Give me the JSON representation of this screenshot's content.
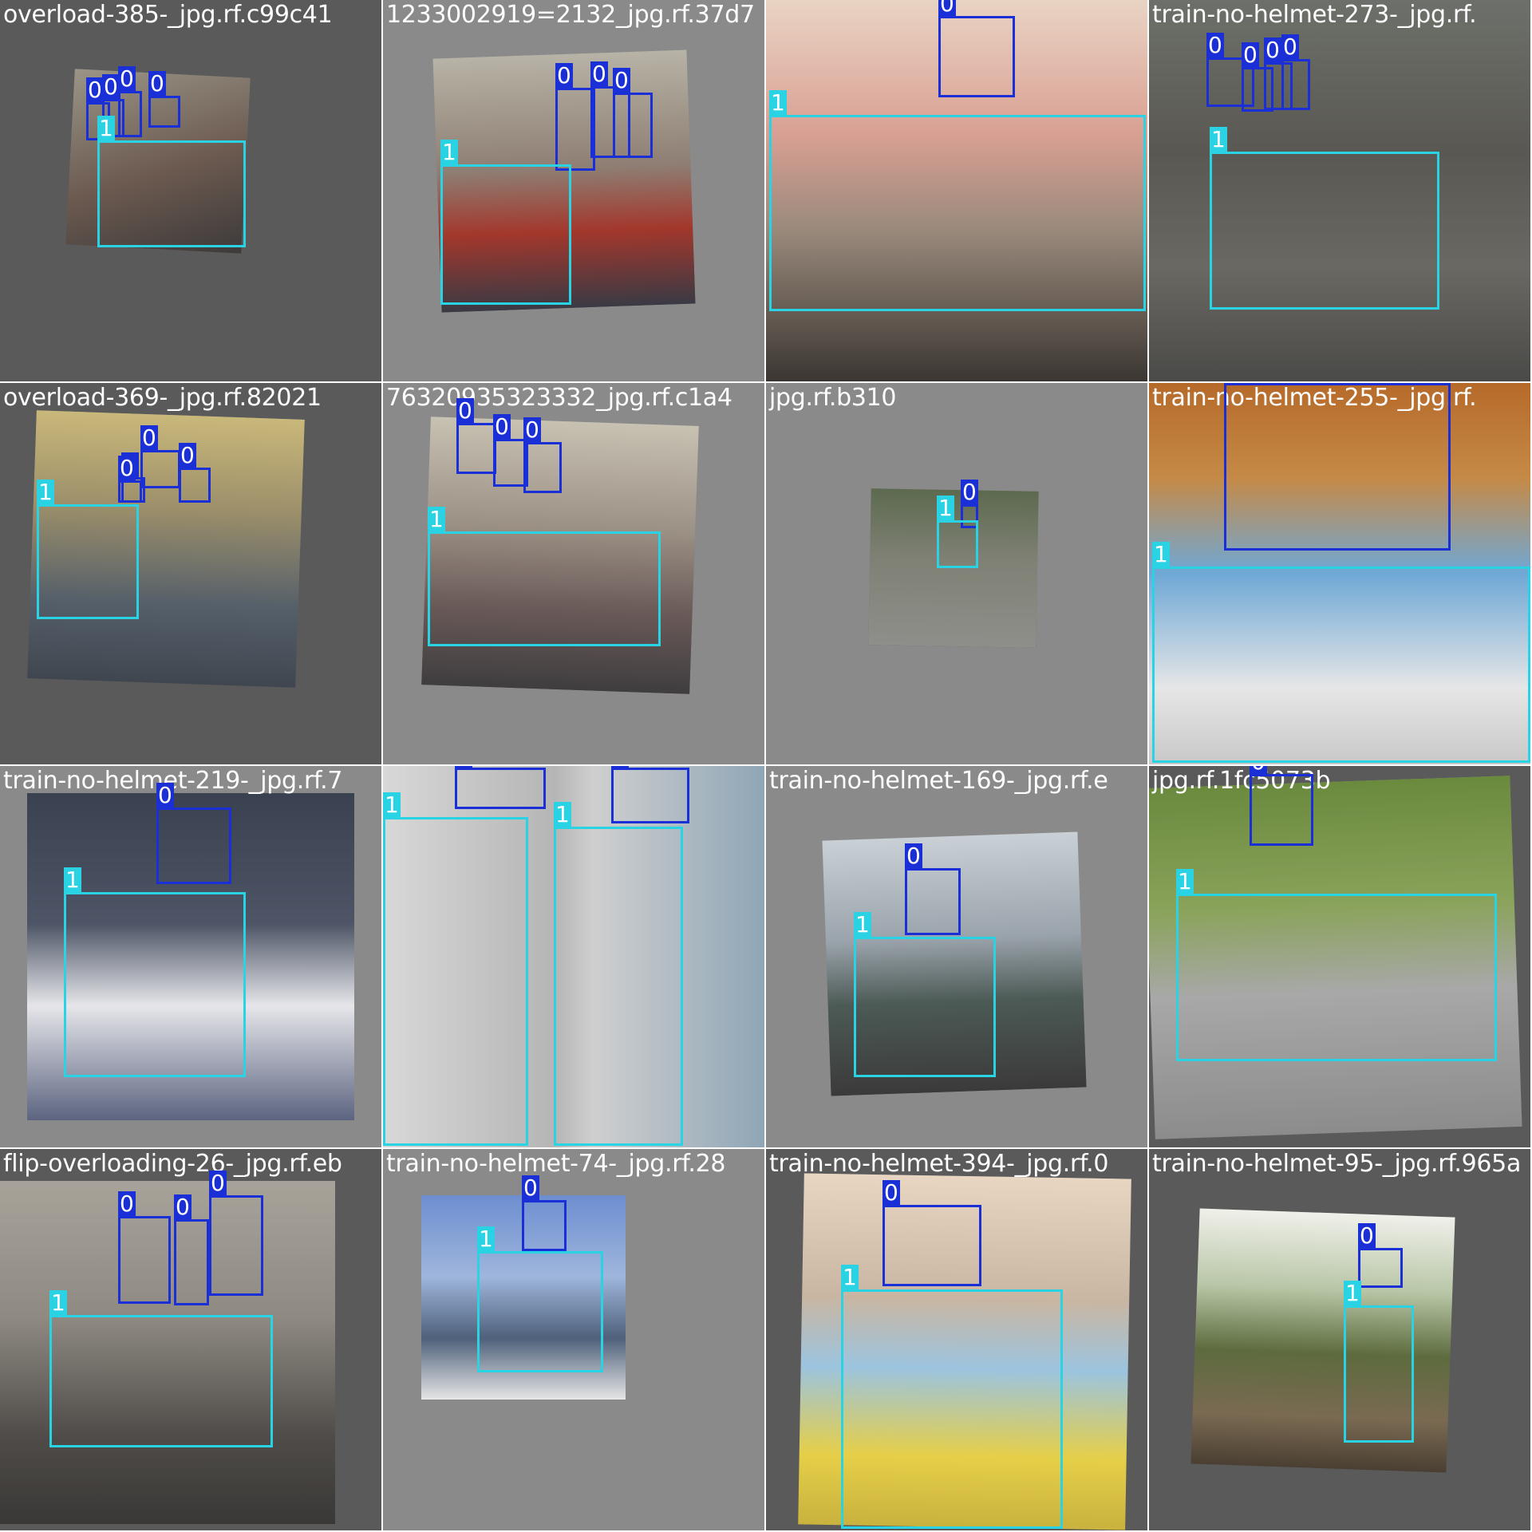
{
  "palette": {
    "class_0": "#1a2fd6",
    "class_1": "#2ad3e3"
  },
  "tiles": [
    {
      "caption": "overload-385-_jpg.rf.c99c41",
      "boxes": [
        "0",
        "0",
        "0",
        "0",
        "1"
      ]
    },
    {
      "caption": "1233002919=2132_jpg.rf.37d7",
      "boxes": [
        "0",
        "0",
        "0",
        "1"
      ]
    },
    {
      "caption": "",
      "boxes": [
        "0",
        "1"
      ]
    },
    {
      "caption": "train-no-helmet-273-_jpg.rf.",
      "boxes": [
        "0",
        "0",
        "0",
        "0",
        "1"
      ]
    },
    {
      "caption": "overload-369-_jpg.rf.82021",
      "boxes": [
        "0",
        "0",
        "0",
        "0",
        "1"
      ]
    },
    {
      "caption": "76320935323332_jpg.rf.c1a4",
      "boxes": [
        "0",
        "0",
        "0",
        "1"
      ]
    },
    {
      "caption": "jpg.rf.b310",
      "boxes": [
        "0",
        "1"
      ]
    },
    {
      "caption": "train-no-helmet-255-_jpg.rf.",
      "boxes": [
        "0",
        "1"
      ]
    },
    {
      "caption": "train-no-helmet-219-_jpg.rf.7",
      "boxes": [
        "0",
        "1"
      ]
    },
    {
      "caption": "",
      "boxes": [
        "0",
        "0",
        "1",
        "1"
      ]
    },
    {
      "caption": "train-no-helmet-169-_jpg.rf.e",
      "boxes": [
        "0",
        "1"
      ]
    },
    {
      "caption": "jpg.rf.1fc5073b",
      "boxes": [
        "0",
        "1"
      ]
    },
    {
      "caption": "flip-overloading-26-_jpg.rf.eb",
      "boxes": [
        "0",
        "0",
        "0",
        "1"
      ]
    },
    {
      "caption": "train-no-helmet-74-_jpg.rf.28",
      "boxes": [
        "0",
        "1"
      ]
    },
    {
      "caption": "train-no-helmet-394-_jpg.rf.0",
      "boxes": [
        "0",
        "1"
      ]
    },
    {
      "caption": "train-no-helmet-95-_jpg.rf.965a",
      "boxes": [
        "0",
        "1"
      ]
    }
  ]
}
